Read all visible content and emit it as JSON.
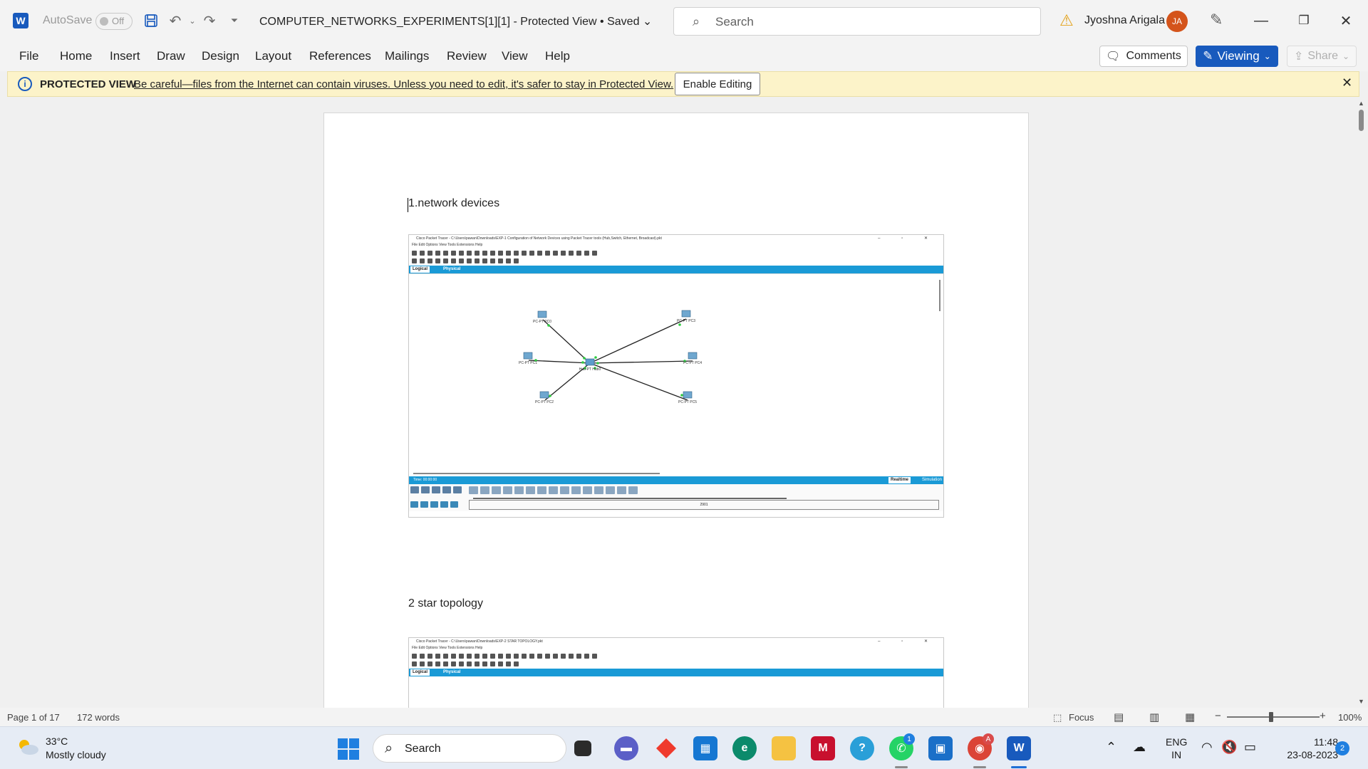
{
  "titlebar": {
    "app_letter": "W",
    "autosave_label": "AutoSave",
    "autosave_state": "Off",
    "doc_title": "COMPUTER_NETWORKS_EXPERIMENTS[1][1]  -  Protected View • Saved",
    "search_placeholder": "Search",
    "user_name": "Jyoshna Arigala",
    "user_initials": "JA"
  },
  "ribbon": {
    "tabs": [
      "File",
      "Home",
      "Insert",
      "Draw",
      "Design",
      "Layout",
      "References",
      "Mailings",
      "Review",
      "View",
      "Help"
    ],
    "comments_label": "Comments",
    "viewing_label": "Viewing",
    "share_label": "Share"
  },
  "protected_view": {
    "title": "PROTECTED VIEW",
    "message": "Be careful—files from the Internet can contain viruses. Unless you need to edit, it's safer to stay in Protected View.",
    "enable_label": "Enable Editing"
  },
  "document": {
    "heading1": "1.network devices",
    "heading2": "2 star topology",
    "shot1": {
      "window_title": "Cisco Packet Tracer - C:\\Users\\pawan\\Downloads\\EXP-1 Configuration of Network Devices using Packet Tracer tools (Hub,Switch, Ethernet, Broadcast).pkt",
      "menu": "File   Edit   Options   View   Tools   Extensions   Help",
      "tab_logical": "Logical",
      "tab_physical": "Physical",
      "time": "Time: 00:00:00",
      "realtime": "Realtime",
      "simulation": "Simulation",
      "center_label": "Hub-PT Hub0",
      "nodes": [
        {
          "label": "PC-PT PC0"
        },
        {
          "label": "PC-PT PC3"
        },
        {
          "label": "PC-PT PC1"
        },
        {
          "label": "PC-PT PC4"
        },
        {
          "label": "PC-PT PC2"
        },
        {
          "label": "PC-PT PC5"
        }
      ],
      "model": "2901"
    },
    "shot2": {
      "window_title": "Cisco Packet Tracer - C:\\Users\\pawan\\Downloads\\EXP-2 STAR TOPOLOGY.pkt",
      "menu": "File   Edit   Options   View   Tools   Extensions   Help",
      "tab_logical": "Logical",
      "tab_physical": "Physical"
    }
  },
  "statusbar": {
    "page": "Page 1 of 17",
    "words": "172 words",
    "focus_label": "Focus",
    "zoom": "100%"
  },
  "taskbar": {
    "weather_temp": "33°C",
    "weather_desc": "Mostly cloudy",
    "search_placeholder": "Search",
    "whatsapp_badge": "1",
    "chrome_badge": "A",
    "lang_top": "ENG",
    "lang_bottom": "IN",
    "time": "11:48",
    "date": "23-08-2023",
    "notifications": "2"
  },
  "colors": {
    "word_blue": "#185abd",
    "pv_bar": "#fcf3c9",
    "packet_tracer_blue": "#1a9ad6",
    "avatar": "#d4541b"
  }
}
